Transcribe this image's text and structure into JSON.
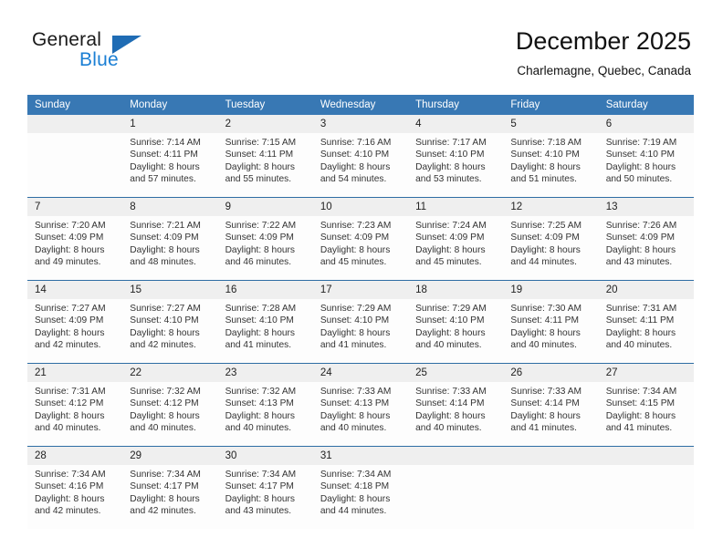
{
  "brand": {
    "name_part1": "General",
    "name_part2": "Blue",
    "logo_icon": "triangle-icon",
    "accent_color": "#1f6cb4",
    "blue_text_color": "#1b7fd4"
  },
  "header": {
    "title": "December 2025",
    "subtitle": "Charlemagne, Quebec, Canada"
  },
  "calendar": {
    "header_background": "#3878b4",
    "datebar_background": "#efefef",
    "separator_color": "#2e6da4",
    "weekdays": [
      "Sunday",
      "Monday",
      "Tuesday",
      "Wednesday",
      "Thursday",
      "Friday",
      "Saturday"
    ],
    "weeks": [
      [
        {
          "day": "",
          "sunrise": "",
          "sunset": "",
          "daylight_line1": "",
          "daylight_line2": ""
        },
        {
          "day": "1",
          "sunrise": "Sunrise: 7:14 AM",
          "sunset": "Sunset: 4:11 PM",
          "daylight_line1": "Daylight: 8 hours",
          "daylight_line2": "and 57 minutes."
        },
        {
          "day": "2",
          "sunrise": "Sunrise: 7:15 AM",
          "sunset": "Sunset: 4:11 PM",
          "daylight_line1": "Daylight: 8 hours",
          "daylight_line2": "and 55 minutes."
        },
        {
          "day": "3",
          "sunrise": "Sunrise: 7:16 AM",
          "sunset": "Sunset: 4:10 PM",
          "daylight_line1": "Daylight: 8 hours",
          "daylight_line2": "and 54 minutes."
        },
        {
          "day": "4",
          "sunrise": "Sunrise: 7:17 AM",
          "sunset": "Sunset: 4:10 PM",
          "daylight_line1": "Daylight: 8 hours",
          "daylight_line2": "and 53 minutes."
        },
        {
          "day": "5",
          "sunrise": "Sunrise: 7:18 AM",
          "sunset": "Sunset: 4:10 PM",
          "daylight_line1": "Daylight: 8 hours",
          "daylight_line2": "and 51 minutes."
        },
        {
          "day": "6",
          "sunrise": "Sunrise: 7:19 AM",
          "sunset": "Sunset: 4:10 PM",
          "daylight_line1": "Daylight: 8 hours",
          "daylight_line2": "and 50 minutes."
        }
      ],
      [
        {
          "day": "7",
          "sunrise": "Sunrise: 7:20 AM",
          "sunset": "Sunset: 4:09 PM",
          "daylight_line1": "Daylight: 8 hours",
          "daylight_line2": "and 49 minutes."
        },
        {
          "day": "8",
          "sunrise": "Sunrise: 7:21 AM",
          "sunset": "Sunset: 4:09 PM",
          "daylight_line1": "Daylight: 8 hours",
          "daylight_line2": "and 48 minutes."
        },
        {
          "day": "9",
          "sunrise": "Sunrise: 7:22 AM",
          "sunset": "Sunset: 4:09 PM",
          "daylight_line1": "Daylight: 8 hours",
          "daylight_line2": "and 46 minutes."
        },
        {
          "day": "10",
          "sunrise": "Sunrise: 7:23 AM",
          "sunset": "Sunset: 4:09 PM",
          "daylight_line1": "Daylight: 8 hours",
          "daylight_line2": "and 45 minutes."
        },
        {
          "day": "11",
          "sunrise": "Sunrise: 7:24 AM",
          "sunset": "Sunset: 4:09 PM",
          "daylight_line1": "Daylight: 8 hours",
          "daylight_line2": "and 45 minutes."
        },
        {
          "day": "12",
          "sunrise": "Sunrise: 7:25 AM",
          "sunset": "Sunset: 4:09 PM",
          "daylight_line1": "Daylight: 8 hours",
          "daylight_line2": "and 44 minutes."
        },
        {
          "day": "13",
          "sunrise": "Sunrise: 7:26 AM",
          "sunset": "Sunset: 4:09 PM",
          "daylight_line1": "Daylight: 8 hours",
          "daylight_line2": "and 43 minutes."
        }
      ],
      [
        {
          "day": "14",
          "sunrise": "Sunrise: 7:27 AM",
          "sunset": "Sunset: 4:09 PM",
          "daylight_line1": "Daylight: 8 hours",
          "daylight_line2": "and 42 minutes."
        },
        {
          "day": "15",
          "sunrise": "Sunrise: 7:27 AM",
          "sunset": "Sunset: 4:10 PM",
          "daylight_line1": "Daylight: 8 hours",
          "daylight_line2": "and 42 minutes."
        },
        {
          "day": "16",
          "sunrise": "Sunrise: 7:28 AM",
          "sunset": "Sunset: 4:10 PM",
          "daylight_line1": "Daylight: 8 hours",
          "daylight_line2": "and 41 minutes."
        },
        {
          "day": "17",
          "sunrise": "Sunrise: 7:29 AM",
          "sunset": "Sunset: 4:10 PM",
          "daylight_line1": "Daylight: 8 hours",
          "daylight_line2": "and 41 minutes."
        },
        {
          "day": "18",
          "sunrise": "Sunrise: 7:29 AM",
          "sunset": "Sunset: 4:10 PM",
          "daylight_line1": "Daylight: 8 hours",
          "daylight_line2": "and 40 minutes."
        },
        {
          "day": "19",
          "sunrise": "Sunrise: 7:30 AM",
          "sunset": "Sunset: 4:11 PM",
          "daylight_line1": "Daylight: 8 hours",
          "daylight_line2": "and 40 minutes."
        },
        {
          "day": "20",
          "sunrise": "Sunrise: 7:31 AM",
          "sunset": "Sunset: 4:11 PM",
          "daylight_line1": "Daylight: 8 hours",
          "daylight_line2": "and 40 minutes."
        }
      ],
      [
        {
          "day": "21",
          "sunrise": "Sunrise: 7:31 AM",
          "sunset": "Sunset: 4:12 PM",
          "daylight_line1": "Daylight: 8 hours",
          "daylight_line2": "and 40 minutes."
        },
        {
          "day": "22",
          "sunrise": "Sunrise: 7:32 AM",
          "sunset": "Sunset: 4:12 PM",
          "daylight_line1": "Daylight: 8 hours",
          "daylight_line2": "and 40 minutes."
        },
        {
          "day": "23",
          "sunrise": "Sunrise: 7:32 AM",
          "sunset": "Sunset: 4:13 PM",
          "daylight_line1": "Daylight: 8 hours",
          "daylight_line2": "and 40 minutes."
        },
        {
          "day": "24",
          "sunrise": "Sunrise: 7:33 AM",
          "sunset": "Sunset: 4:13 PM",
          "daylight_line1": "Daylight: 8 hours",
          "daylight_line2": "and 40 minutes."
        },
        {
          "day": "25",
          "sunrise": "Sunrise: 7:33 AM",
          "sunset": "Sunset: 4:14 PM",
          "daylight_line1": "Daylight: 8 hours",
          "daylight_line2": "and 40 minutes."
        },
        {
          "day": "26",
          "sunrise": "Sunrise: 7:33 AM",
          "sunset": "Sunset: 4:14 PM",
          "daylight_line1": "Daylight: 8 hours",
          "daylight_line2": "and 41 minutes."
        },
        {
          "day": "27",
          "sunrise": "Sunrise: 7:34 AM",
          "sunset": "Sunset: 4:15 PM",
          "daylight_line1": "Daylight: 8 hours",
          "daylight_line2": "and 41 minutes."
        }
      ],
      [
        {
          "day": "28",
          "sunrise": "Sunrise: 7:34 AM",
          "sunset": "Sunset: 4:16 PM",
          "daylight_line1": "Daylight: 8 hours",
          "daylight_line2": "and 42 minutes."
        },
        {
          "day": "29",
          "sunrise": "Sunrise: 7:34 AM",
          "sunset": "Sunset: 4:17 PM",
          "daylight_line1": "Daylight: 8 hours",
          "daylight_line2": "and 42 minutes."
        },
        {
          "day": "30",
          "sunrise": "Sunrise: 7:34 AM",
          "sunset": "Sunset: 4:17 PM",
          "daylight_line1": "Daylight: 8 hours",
          "daylight_line2": "and 43 minutes."
        },
        {
          "day": "31",
          "sunrise": "Sunrise: 7:34 AM",
          "sunset": "Sunset: 4:18 PM",
          "daylight_line1": "Daylight: 8 hours",
          "daylight_line2": "and 44 minutes."
        },
        {
          "day": "",
          "sunrise": "",
          "sunset": "",
          "daylight_line1": "",
          "daylight_line2": ""
        },
        {
          "day": "",
          "sunrise": "",
          "sunset": "",
          "daylight_line1": "",
          "daylight_line2": ""
        },
        {
          "day": "",
          "sunrise": "",
          "sunset": "",
          "daylight_line1": "",
          "daylight_line2": ""
        }
      ]
    ]
  }
}
